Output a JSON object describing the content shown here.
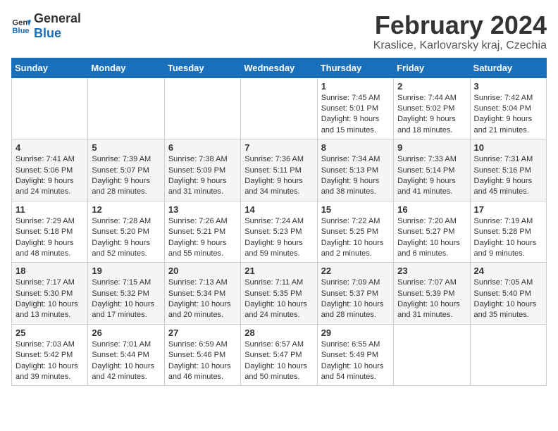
{
  "header": {
    "logo": {
      "general": "General",
      "blue": "Blue",
      "icon_color": "#1a6fba"
    },
    "title": "February 2024",
    "subtitle": "Kraslice, Karlovarsky kraj, Czechia"
  },
  "calendar": {
    "days_of_week": [
      "Sunday",
      "Monday",
      "Tuesday",
      "Wednesday",
      "Thursday",
      "Friday",
      "Saturday"
    ],
    "weeks": [
      [
        {
          "day": "",
          "info": ""
        },
        {
          "day": "",
          "info": ""
        },
        {
          "day": "",
          "info": ""
        },
        {
          "day": "",
          "info": ""
        },
        {
          "day": "1",
          "info": "Sunrise: 7:45 AM\nSunset: 5:01 PM\nDaylight: 9 hours\nand 15 minutes."
        },
        {
          "day": "2",
          "info": "Sunrise: 7:44 AM\nSunset: 5:02 PM\nDaylight: 9 hours\nand 18 minutes."
        },
        {
          "day": "3",
          "info": "Sunrise: 7:42 AM\nSunset: 5:04 PM\nDaylight: 9 hours\nand 21 minutes."
        }
      ],
      [
        {
          "day": "4",
          "info": "Sunrise: 7:41 AM\nSunset: 5:06 PM\nDaylight: 9 hours\nand 24 minutes."
        },
        {
          "day": "5",
          "info": "Sunrise: 7:39 AM\nSunset: 5:07 PM\nDaylight: 9 hours\nand 28 minutes."
        },
        {
          "day": "6",
          "info": "Sunrise: 7:38 AM\nSunset: 5:09 PM\nDaylight: 9 hours\nand 31 minutes."
        },
        {
          "day": "7",
          "info": "Sunrise: 7:36 AM\nSunset: 5:11 PM\nDaylight: 9 hours\nand 34 minutes."
        },
        {
          "day": "8",
          "info": "Sunrise: 7:34 AM\nSunset: 5:13 PM\nDaylight: 9 hours\nand 38 minutes."
        },
        {
          "day": "9",
          "info": "Sunrise: 7:33 AM\nSunset: 5:14 PM\nDaylight: 9 hours\nand 41 minutes."
        },
        {
          "day": "10",
          "info": "Sunrise: 7:31 AM\nSunset: 5:16 PM\nDaylight: 9 hours\nand 45 minutes."
        }
      ],
      [
        {
          "day": "11",
          "info": "Sunrise: 7:29 AM\nSunset: 5:18 PM\nDaylight: 9 hours\nand 48 minutes."
        },
        {
          "day": "12",
          "info": "Sunrise: 7:28 AM\nSunset: 5:20 PM\nDaylight: 9 hours\nand 52 minutes."
        },
        {
          "day": "13",
          "info": "Sunrise: 7:26 AM\nSunset: 5:21 PM\nDaylight: 9 hours\nand 55 minutes."
        },
        {
          "day": "14",
          "info": "Sunrise: 7:24 AM\nSunset: 5:23 PM\nDaylight: 9 hours\nand 59 minutes."
        },
        {
          "day": "15",
          "info": "Sunrise: 7:22 AM\nSunset: 5:25 PM\nDaylight: 10 hours\nand 2 minutes."
        },
        {
          "day": "16",
          "info": "Sunrise: 7:20 AM\nSunset: 5:27 PM\nDaylight: 10 hours\nand 6 minutes."
        },
        {
          "day": "17",
          "info": "Sunrise: 7:19 AM\nSunset: 5:28 PM\nDaylight: 10 hours\nand 9 minutes."
        }
      ],
      [
        {
          "day": "18",
          "info": "Sunrise: 7:17 AM\nSunset: 5:30 PM\nDaylight: 10 hours\nand 13 minutes."
        },
        {
          "day": "19",
          "info": "Sunrise: 7:15 AM\nSunset: 5:32 PM\nDaylight: 10 hours\nand 17 minutes."
        },
        {
          "day": "20",
          "info": "Sunrise: 7:13 AM\nSunset: 5:34 PM\nDaylight: 10 hours\nand 20 minutes."
        },
        {
          "day": "21",
          "info": "Sunrise: 7:11 AM\nSunset: 5:35 PM\nDaylight: 10 hours\nand 24 minutes."
        },
        {
          "day": "22",
          "info": "Sunrise: 7:09 AM\nSunset: 5:37 PM\nDaylight: 10 hours\nand 28 minutes."
        },
        {
          "day": "23",
          "info": "Sunrise: 7:07 AM\nSunset: 5:39 PM\nDaylight: 10 hours\nand 31 minutes."
        },
        {
          "day": "24",
          "info": "Sunrise: 7:05 AM\nSunset: 5:40 PM\nDaylight: 10 hours\nand 35 minutes."
        }
      ],
      [
        {
          "day": "25",
          "info": "Sunrise: 7:03 AM\nSunset: 5:42 PM\nDaylight: 10 hours\nand 39 minutes."
        },
        {
          "day": "26",
          "info": "Sunrise: 7:01 AM\nSunset: 5:44 PM\nDaylight: 10 hours\nand 42 minutes."
        },
        {
          "day": "27",
          "info": "Sunrise: 6:59 AM\nSunset: 5:46 PM\nDaylight: 10 hours\nand 46 minutes."
        },
        {
          "day": "28",
          "info": "Sunrise: 6:57 AM\nSunset: 5:47 PM\nDaylight: 10 hours\nand 50 minutes."
        },
        {
          "day": "29",
          "info": "Sunrise: 6:55 AM\nSunset: 5:49 PM\nDaylight: 10 hours\nand 54 minutes."
        },
        {
          "day": "",
          "info": ""
        },
        {
          "day": "",
          "info": ""
        }
      ]
    ]
  }
}
